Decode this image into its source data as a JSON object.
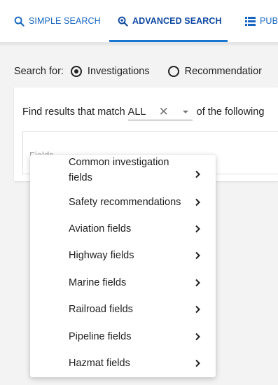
{
  "tabs": {
    "simple": "SIMPLE SEARCH",
    "advanced": "ADVANCED SEARCH",
    "publications": "PUBLI"
  },
  "search_for": {
    "label": "Search for:",
    "option1": "Investigations",
    "option2": "Recommendatior",
    "selected": "Investigations"
  },
  "match": {
    "prefix": "Find results that match",
    "value": "ALL",
    "suffix": "of the following"
  },
  "field": {
    "label": "Fields"
  },
  "menu": {
    "items": [
      {
        "line1": "Common investigation",
        "line2": "fields"
      },
      {
        "line1": "Safety recommendations"
      },
      {
        "line1": "Aviation fields"
      },
      {
        "line1": "Highway fields"
      },
      {
        "line1": "Marine fields"
      },
      {
        "line1": "Railroad fields"
      },
      {
        "line1": "Pipeline fields"
      },
      {
        "line1": "Hazmat fields"
      }
    ]
  },
  "colors": {
    "accent": "#1976d2",
    "background": "#f3f3f3"
  },
  "icons": [
    "search-icon",
    "advanced-search-icon",
    "list-icon",
    "close-icon",
    "dropdown-arrow-icon",
    "chevron-right-icon"
  ]
}
